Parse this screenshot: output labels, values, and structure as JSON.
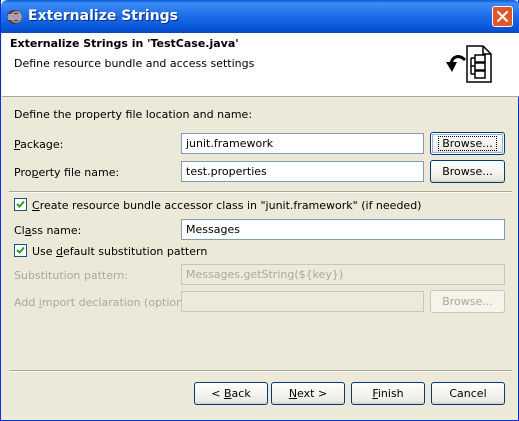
{
  "window": {
    "title": "Externalize Strings"
  },
  "header": {
    "title": "Externalize Strings in 'TestCase.java'",
    "description": "Define resource bundle and access settings"
  },
  "form": {
    "section_label": "Define the property file location and name:",
    "package": {
      "label_pre": "",
      "label_u": "P",
      "label_post": "ackage:",
      "value": "junit.framework",
      "browse_label": "Browse..."
    },
    "property_file": {
      "label_pre": "Pro",
      "label_u": "p",
      "label_post": "erty file name:",
      "value": "test.properties",
      "browse_label": "Browse..."
    },
    "create_accessor": {
      "checked": true,
      "label_pre": "",
      "label_u": "C",
      "label_post": "reate resource bundle accessor class in \"junit.framework\" (if needed)"
    },
    "class_name": {
      "label_pre": "Cl",
      "label_u": "a",
      "label_post": "ss name:",
      "value": "Messages"
    },
    "default_pattern": {
      "checked": true,
      "label_pre": "Use ",
      "label_u": "d",
      "label_post": "efault substitution pattern"
    },
    "substitution": {
      "label": "Substitution pattern:",
      "value": "Messages.getString(${key})"
    },
    "add_import": {
      "label_pre": "Add ",
      "label_u": "i",
      "label_post": "mport declaration (optional):",
      "value": "",
      "browse_label": "Browse..."
    }
  },
  "buttons": {
    "back_pre": "< ",
    "back_u": "B",
    "back_post": "ack",
    "next_pre": "",
    "next_u": "N",
    "next_post": "ext >",
    "finish_pre": "",
    "finish_u": "F",
    "finish_post": "inish",
    "cancel": "Cancel"
  },
  "colors": {
    "titlebar": "#0553d6",
    "close_button": "#e2572a",
    "dialog_bg": "#ece9d8"
  }
}
